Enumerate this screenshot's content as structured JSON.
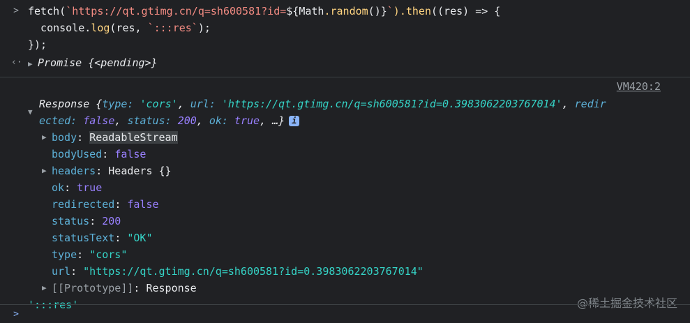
{
  "input": {
    "line1_fetch": "fetch(",
    "line1_tmpl_open": "`https://qt.gtimg.cn/q=sh600581?id=",
    "line1_tmpl_expr_open": "${",
    "line1_math": "Math",
    "line1_random": ".random",
    "line1_parens": "()",
    "line1_tmpl_expr_close": "}",
    "line1_tmpl_close": "`",
    "line1_then": ").then",
    "line1_rest": "((res) => {",
    "line2_console": "  console.",
    "line2_log": "log",
    "line2_args": "(res, ",
    "line2_str": "`:::res`",
    "line2_end": ");",
    "line3": "});"
  },
  "promise": {
    "label": "Promise",
    "state": "{<pending>}"
  },
  "vm_link": "VM420:2",
  "response": {
    "label": "Response",
    "summary_open": "{",
    "type_key": "type:",
    "type_val": "'cors'",
    "url_key": "url:",
    "url_val": "'https://qt.gtimg.cn/q=sh600581?id=0.3983062203767014'",
    "redir_key_a": "redir",
    "redir_key_b": "ected:",
    "redir_val": "false",
    "status_key": "status:",
    "status_val": "200",
    "ok_key": "ok:",
    "ok_val": "true",
    "summary_close": "…}",
    "info_icon": "i"
  },
  "properties": [
    {
      "key": "body",
      "value": "ReadableStream",
      "expandable": true
    },
    {
      "key": "bodyUsed",
      "value": "false",
      "expandable": false
    },
    {
      "key": "headers",
      "value": "Headers {}",
      "expandable": true
    },
    {
      "key": "ok",
      "value": "true",
      "expandable": false
    },
    {
      "key": "redirected",
      "value": "false",
      "expandable": false
    },
    {
      "key": "status",
      "value": "200",
      "expandable": false
    },
    {
      "key": "statusText",
      "value": "\"OK\"",
      "expandable": false
    },
    {
      "key": "type",
      "value": "\"cors\"",
      "expandable": false
    },
    {
      "key": "url",
      "value": "\"https://qt.gtimg.cn/q=sh600581?id=0.3983062203767014\"",
      "expandable": false
    },
    {
      "key": "[[Prototype]]",
      "value": "Response",
      "expandable": true
    }
  ],
  "log_output": "':::res'",
  "watermark": "@稀土掘金技术社区",
  "glyphs": {
    "prompt": ">",
    "result": "‹·",
    "collapsed": "▶",
    "expanded": "▼"
  },
  "colors": {
    "background": "#202124",
    "string": "#35d4c7",
    "number_bool": "#9980ff",
    "key": "#5db0d7"
  }
}
